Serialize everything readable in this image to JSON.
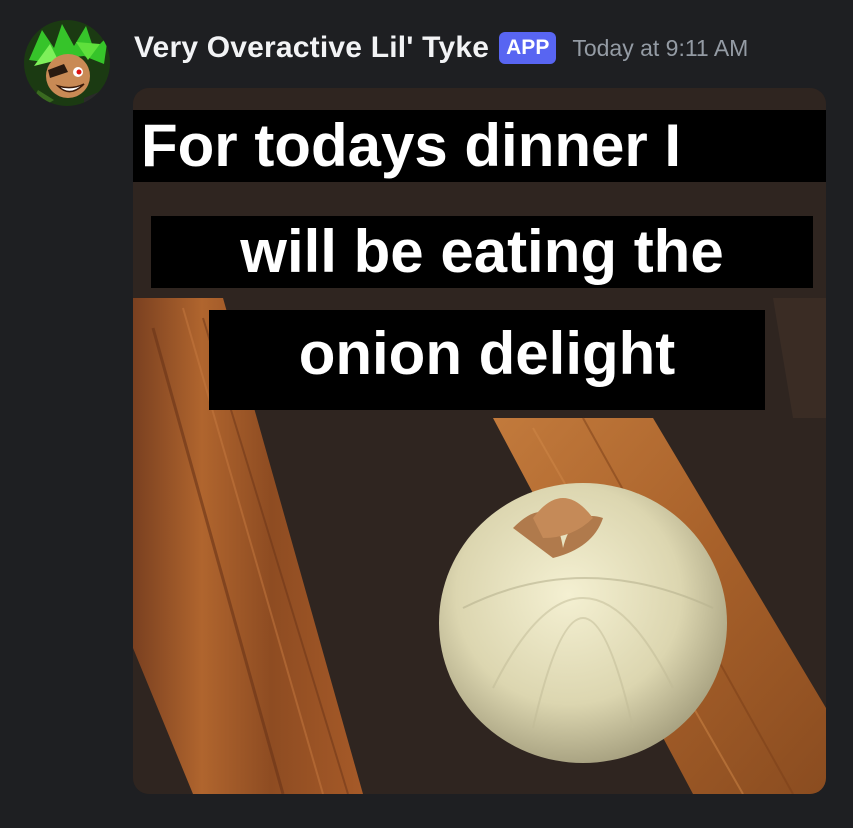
{
  "message": {
    "author": {
      "name": "Very Overactive Lil' Tyke",
      "badge": "APP",
      "avatar_icon": "bot-avatar-icon"
    },
    "timestamp": "Today at 9:11 AM",
    "attachment": {
      "caption_lines": [
        "For todays dinner I",
        "will be eating the",
        "onion delight"
      ]
    }
  },
  "colors": {
    "background": "#1e1f22",
    "username": "#f2f3f5",
    "badge": "#5865f2",
    "timestamp": "#949ba4"
  }
}
